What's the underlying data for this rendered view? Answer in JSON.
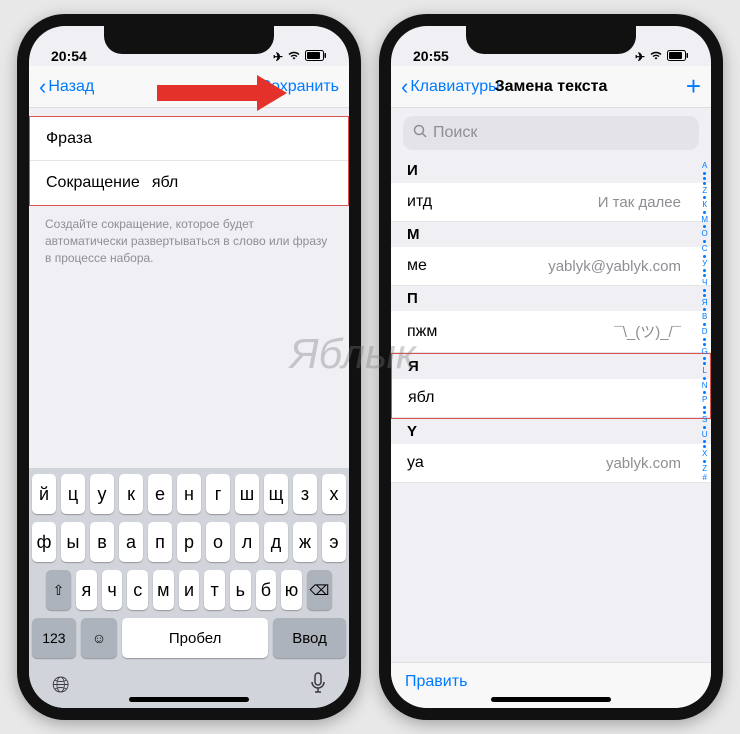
{
  "left": {
    "time": "20:54",
    "back": "Назад",
    "save": "Сохранить",
    "phrase_label": "Фраза",
    "phrase_value": "",
    "shortcut_label": "Сокращение",
    "shortcut_value": "ябл",
    "hint": "Создайте сокращение, которое будет автоматически развертываться в слово или фразу в процессе набора.",
    "keyboard": {
      "r1": [
        "й",
        "ц",
        "у",
        "к",
        "е",
        "н",
        "г",
        "ш",
        "щ",
        "з",
        "х"
      ],
      "r2": [
        "ф",
        "ы",
        "в",
        "а",
        "п",
        "р",
        "о",
        "л",
        "д",
        "ж",
        "э"
      ],
      "r3": [
        "я",
        "ч",
        "с",
        "м",
        "и",
        "т",
        "ь",
        "б",
        "ю"
      ],
      "num": "123",
      "space": "Пробел",
      "enter": "Ввод"
    }
  },
  "right": {
    "time": "20:55",
    "back": "Клавиатуры",
    "title": "Замена текста",
    "search_placeholder": "Поиск",
    "sections": [
      {
        "hd": "И",
        "rows": [
          {
            "k": "итд",
            "v": "И так далее"
          }
        ]
      },
      {
        "hd": "М",
        "rows": [
          {
            "k": "ме",
            "v": "yablyk@yablyk.com"
          }
        ]
      },
      {
        "hd": "П",
        "rows": [
          {
            "k": "пжм",
            "v": "¯\\_(ツ)_/¯"
          }
        ]
      },
      {
        "hd": "Я",
        "rows": [
          {
            "k": "ябл",
            "v": ""
          }
        ],
        "highlight": true
      },
      {
        "hd": "Y",
        "rows": [
          {
            "k": "уа",
            "v": "yablyk.com"
          }
        ]
      }
    ],
    "edit": "Править",
    "index": [
      "А",
      "•",
      "•",
      "•",
      "Z",
      "•",
      "К",
      "•",
      "М",
      "•",
      "О",
      "•",
      "С",
      "•",
      "У",
      "•",
      "•",
      "Ч",
      "•",
      "•",
      "Я",
      "•",
      "В",
      "•",
      "D",
      "•",
      "•",
      "G",
      "•",
      "•",
      "L",
      "•",
      "N",
      "•",
      "P",
      "•",
      "•",
      "S",
      "•",
      "U",
      "•",
      "•",
      "X",
      "•",
      "Z",
      "#"
    ]
  },
  "watermark": "Яблык"
}
